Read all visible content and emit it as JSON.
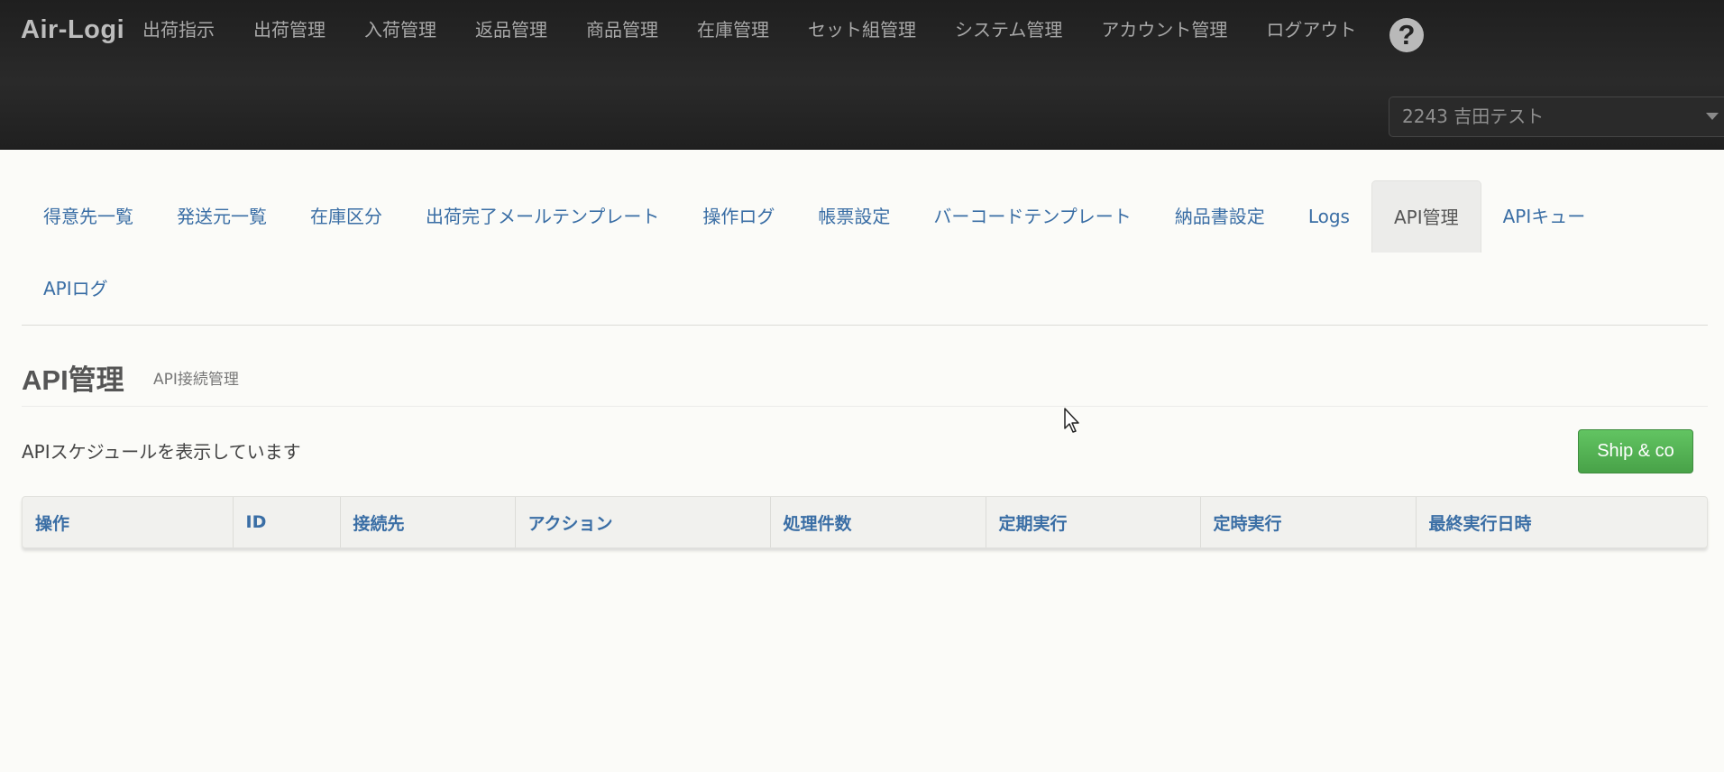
{
  "app": {
    "brand": "Air-Logi",
    "nav": [
      "出荷指示",
      "出荷管理",
      "入荷管理",
      "返品管理",
      "商品管理",
      "在庫管理",
      "セット組管理",
      "システム管理",
      "アカウント管理",
      "ログアウト"
    ],
    "help_icon": "?",
    "company_select": "2243 吉田テスト"
  },
  "tabs": {
    "row1": [
      "得意先一覧",
      "発送元一覧",
      "在庫区分",
      "出荷完了メールテンプレート",
      "操作ログ",
      "帳票設定",
      "バーコードテンプレート",
      "納品書設定",
      "Logs",
      "API管理",
      "APIキュー"
    ],
    "row2": [
      "APIログ"
    ],
    "active": "API管理"
  },
  "page": {
    "title": "API管理",
    "subtitle": "API接続管理",
    "description": "APIスケジュールを表示しています",
    "ship_button": "Ship & co"
  },
  "table": {
    "headers": [
      "操作",
      "ID",
      "接続先",
      "アクション",
      "処理件数",
      "定期実行",
      "定時実行",
      "最終実行日時"
    ]
  },
  "colors": {
    "accent_link": "#3a6ea5",
    "button_green": "#54b354",
    "topbar": "#262626"
  }
}
